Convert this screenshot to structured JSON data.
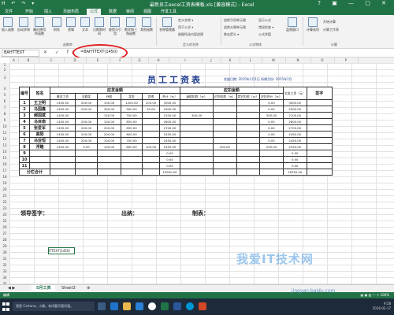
{
  "window": {
    "title": "最新员工excel工资表模板.xls [兼容模式] - Excel",
    "quick_access": "H ↶ ↷ ▾",
    "controls": "? ▣ — ▢ ✕"
  },
  "tabs": [
    "文件",
    "开始",
    "插入",
    "页面布局",
    "公式",
    "数据",
    "审阅",
    "视图",
    "开发工具"
  ],
  "ribbon": {
    "buttons": [
      "插入函数",
      "自动求和",
      "最近使用的函数",
      "财务",
      "逻辑",
      "文本",
      "日期和时间",
      "查找与引用",
      "数学和三角函数",
      "其他函数"
    ],
    "name_manager": "名称管理器",
    "define_name_items": [
      "定义名称 ▾",
      "用于公式 ▾",
      "根据所选内容创建"
    ],
    "audit_items": [
      "追踪引用单元格",
      "追踪从属单元格",
      "移去箭头 ▾"
    ],
    "audit_items2": [
      "显示公式",
      "错误检查 ▾",
      "公式求值"
    ],
    "watch": "监视窗口",
    "calc_options": "计算选项",
    "calc_items": [
      "开始计算",
      "计算工作表"
    ],
    "groups": [
      "函数库",
      "定义的名称",
      "公式审核",
      "计算"
    ]
  },
  "formula_bar": {
    "name_box": "BAHTTEXT",
    "fx_icons": "✕ ✓ fx",
    "formula": "=BAHTTEXT(1450)"
  },
  "columns": [
    "A",
    "B",
    "C",
    "D",
    "E",
    "F",
    "G",
    "H",
    "I",
    "J",
    "K",
    "L",
    "M",
    "N",
    "O",
    "P"
  ],
  "rows": [
    "1",
    "2",
    "3",
    "4",
    "5",
    "6",
    "7",
    "8",
    "9",
    "10",
    "11",
    "12",
    "13",
    "14",
    "15",
    "16",
    "17",
    "18",
    "19",
    "20",
    "21",
    "22",
    "23",
    "24",
    "25",
    "26",
    "27",
    "28",
    "29",
    "30",
    "31",
    "32",
    "33",
    "34",
    "35"
  ],
  "sheet": {
    "title": "员工工资表",
    "dateline": "发放日期: 2015年1月1日   所属月份: 2015年1月",
    "headers": {
      "id": "编号",
      "name": "姓名",
      "payable_group": "应发金额",
      "deduct_group": "应扣金额",
      "actual": "实发工资（元）",
      "sign": "签字",
      "sub": [
        "基本工资",
        "全勤奖",
        "补助",
        "奖金",
        "其他",
        "合计（元）",
        "请假扣款（元）",
        "迟到扣款（元）",
        "其它扣款（元）",
        "应扣合计（元）"
      ]
    },
    "rows": [
      [
        "1",
        "王卫明",
        "1450.00",
        "200.00",
        "100.00",
        "1200.00",
        "200.00",
        "3000.00",
        "",
        "",
        "",
        "0.00",
        "3000.00"
      ],
      [
        "2",
        "马国鑫",
        "1450.00",
        "200.00",
        "300.00",
        "900.00",
        "50.00",
        "2900.00",
        "",
        "",
        "",
        "0.00",
        "2900.00"
      ],
      [
        "3",
        "郝国斌",
        "1450.00",
        "",
        "150.00",
        "700.00",
        "",
        "2100.00",
        "300.00",
        "",
        "",
        "300.00",
        "2100.00"
      ],
      [
        "4",
        "马目南",
        "1450.00",
        "200.00",
        "100.00",
        "850.00",
        "",
        "2600.00",
        "",
        "",
        "",
        "0.00",
        "2600.00"
      ],
      [
        "5",
        "张爱军",
        "1450.00",
        "200.00",
        "200.00",
        "850.00",
        "",
        "2700.00",
        "",
        "",
        "",
        "0.00",
        "2700.00"
      ],
      [
        "6",
        "高阳",
        "1450.00",
        "200.00",
        "200.00",
        "600.00",
        "",
        "2450.00",
        "",
        "",
        "",
        "0.00",
        "2450.00"
      ],
      [
        "7",
        "马亚恒",
        "1450.00",
        "200.00",
        "100.00",
        "700.00",
        "",
        "2450.00",
        "",
        "",
        "",
        "0.00",
        "2450.00"
      ],
      [
        "8",
        "浮趣",
        "1450.00",
        "0.00",
        "100.00",
        "800.00",
        "100.00",
        "2450.00",
        "",
        "200.00",
        "",
        "200.00",
        "2250.00"
      ],
      [
        "9",
        "",
        "",
        "",
        "",
        "",
        "",
        "0.00",
        "",
        "",
        "",
        "",
        "0.00"
      ],
      [
        "10",
        "",
        "",
        "",
        "",
        "",
        "",
        "0.00",
        "",
        "",
        "",
        "",
        "0.00"
      ],
      [
        "11",
        "",
        "",
        "",
        "",
        "",
        "",
        "0.00",
        "",
        "",
        "",
        "",
        "0.00"
      ]
    ],
    "total_label": "分栏合计",
    "total_value": "19900.00",
    "total_actual": "18750.00",
    "footer": {
      "leader": "领导签字：",
      "cashier": "出纳：",
      "maker": "制表："
    },
    "selected_cell": "ITTEXT(1450)"
  },
  "sheet_tabs": {
    "nav": "◀ ▶",
    "items": [
      "5月工资",
      "Sheet3"
    ],
    "add": "⊕"
  },
  "status": {
    "left": "编辑",
    "right": "▦ ▣ ▥ — + 100%"
  },
  "taskbar": {
    "search": "我是 Cortana，小娜。有问题尽管问我。",
    "time": "9:58",
    "date": "2016-02-17"
  },
  "watermark": {
    "text": "我爱IT技术网",
    "url": "jingyan.baidu.com"
  },
  "colors": {
    "excel_green": "#217346",
    "title_blue": "#1b3a8c",
    "circle_red": "#e02020"
  }
}
